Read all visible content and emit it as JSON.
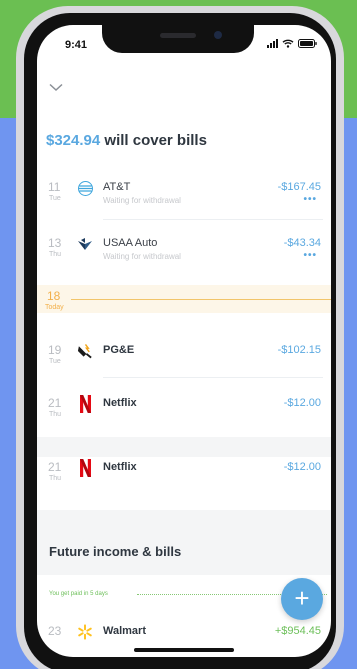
{
  "status_bar": {
    "time": "9:41"
  },
  "header": {
    "amount": "$324.94",
    "title_suffix": " will cover bills"
  },
  "transactions": [
    {
      "day": "11",
      "weekday": "Tue",
      "name": "AT&T",
      "status": "Waiting for withdrawal",
      "amount": "-$167.45",
      "more": "•••",
      "logo": "att-logo"
    },
    {
      "day": "13",
      "weekday": "Thu",
      "name": "USAA Auto",
      "status": "Waiting for withdrawal",
      "amount": "-$43.34",
      "more": "•••",
      "logo": "usaa-logo"
    }
  ],
  "today": {
    "day": "18",
    "label": "Today"
  },
  "upcoming": [
    {
      "day": "19",
      "weekday": "Tue",
      "name": "PG&E",
      "amount": "-$102.15",
      "logo": "pge-logo"
    },
    {
      "day": "21",
      "weekday": "Thu",
      "name": "Netflix",
      "amount": "-$12.00",
      "logo": "netflix-logo"
    },
    {
      "day": "21",
      "weekday": "Thu",
      "name": "Netflix",
      "amount": "-$12.00",
      "logo": "netflix-logo"
    }
  ],
  "future": {
    "title": "Future income & bills",
    "paid_note": "You get paid in 5 days",
    "items": [
      {
        "day": "23",
        "name": "Walmart",
        "amount": "+$954.45",
        "logo": "walmart-logo"
      }
    ]
  },
  "fab_label": "+",
  "colors": {
    "accent": "#5aa8e0",
    "income": "#6cbf59",
    "today": "#f2b04b",
    "netflix": "#e50914",
    "walmart": "#ffc220"
  }
}
